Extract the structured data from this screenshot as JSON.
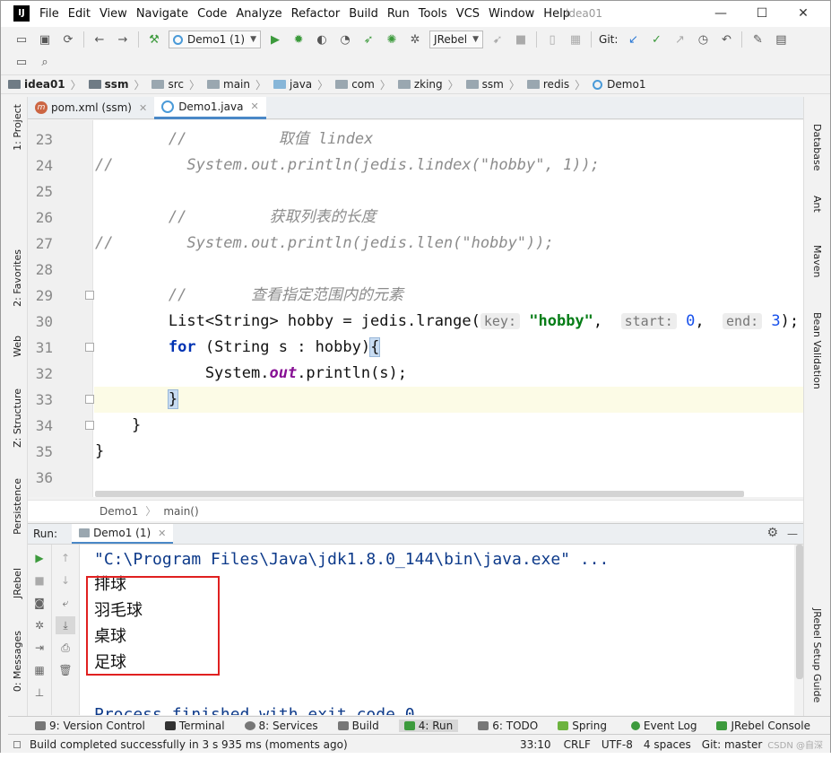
{
  "titlebar": {
    "title": "idea01",
    "menu": [
      "File",
      "Edit",
      "View",
      "Navigate",
      "Code",
      "Analyze",
      "Refactor",
      "Build",
      "Run",
      "Tools",
      "VCS",
      "Window",
      "Help"
    ],
    "minimize_label": "—",
    "maximize_label": "☐",
    "close_label": "✕"
  },
  "toolbar": {
    "run_config": "Demo1 (1)",
    "jrebel": "JRebel",
    "git_label": "Git:"
  },
  "breadcrumb": [
    "idea01",
    "ssm",
    "src",
    "main",
    "java",
    "com",
    "zking",
    "ssm",
    "redis",
    "Demo1"
  ],
  "tabs": [
    {
      "label": "pom.xml (ssm)"
    },
    {
      "label": "Demo1.java"
    }
  ],
  "left_tools": [
    "1: Project",
    "2: Favorites",
    "Web",
    "Z: Structure",
    "Persistence",
    "JRebel",
    "0: Messages"
  ],
  "right_tools": [
    "Database",
    "Ant",
    "Maven",
    "Bean Validation",
    "JRebel Setup Guide"
  ],
  "editor": {
    "lines": [
      {
        "n": "23",
        "parts": [
          [
            "        ",
            ""
          ],
          [
            "//          取值 lindex",
            "cm"
          ]
        ]
      },
      {
        "n": "24",
        "parts": [
          [
            "//        System.out.println(jedis.lindex(\"hobby\", 1));",
            "cm"
          ]
        ]
      },
      {
        "n": "25",
        "parts": [
          [
            "",
            ""
          ]
        ]
      },
      {
        "n": "26",
        "parts": [
          [
            "        ",
            ""
          ],
          [
            "//         获取列表的长度",
            "cm"
          ]
        ]
      },
      {
        "n": "27",
        "parts": [
          [
            "//        System.out.println(jedis.llen(\"hobby\"));",
            "cm"
          ]
        ]
      },
      {
        "n": "28",
        "parts": [
          [
            "",
            ""
          ]
        ]
      },
      {
        "n": "29",
        "parts": [
          [
            "        ",
            ""
          ],
          [
            "//       查看指定范围内的元素",
            "cm"
          ]
        ]
      },
      {
        "n": "30",
        "parts": [
          [
            "        List<String> hobby = jedis.lrange(",
            ""
          ],
          [
            "key:",
            "hint"
          ],
          [
            "\"hobby\"",
            "str"
          ],
          [
            ",  ",
            ""
          ],
          [
            "start:",
            "hint"
          ],
          [
            "0",
            "num"
          ],
          [
            ",  ",
            ""
          ],
          [
            "end:",
            "hint"
          ],
          [
            "3",
            "num"
          ],
          [
            ");",
            ""
          ]
        ]
      },
      {
        "n": "31",
        "parts": [
          [
            "        ",
            ""
          ],
          [
            "for",
            "kw"
          ],
          [
            " (String s : hobby)",
            ""
          ],
          [
            "{",
            "brace"
          ]
        ]
      },
      {
        "n": "32",
        "parts": [
          [
            "            System.",
            ""
          ],
          [
            "out",
            "fld"
          ],
          [
            ".println(s);",
            ""
          ]
        ]
      },
      {
        "n": "33",
        "parts": [
          [
            "        ",
            ""
          ],
          [
            "}",
            "brace"
          ]
        ]
      },
      {
        "n": "34",
        "parts": [
          [
            "    }",
            ""
          ]
        ]
      },
      {
        "n": "35",
        "parts": [
          [
            "}",
            ""
          ]
        ]
      },
      {
        "n": "36",
        "parts": [
          [
            "",
            ""
          ]
        ]
      }
    ],
    "breadcrumb": [
      "Demo1",
      "main()"
    ]
  },
  "run_panel": {
    "label": "Run:",
    "tab": "Demo1 (1)",
    "console_cmd": "\"C:\\Program Files\\Java\\jdk1.8.0_144\\bin\\java.exe\" ...",
    "output": [
      "排球",
      "羽毛球",
      "桌球",
      "足球"
    ],
    "finished": "Process finished with exit code 0"
  },
  "bottom_tabs": [
    "9: Version Control",
    "Terminal",
    "8: Services",
    "Build",
    "4: Run",
    "6: TODO",
    "Spring",
    "Event Log",
    "JRebel Console"
  ],
  "status": {
    "message": "Build completed successfully in 3 s 935 ms (moments ago)",
    "position": "33:10",
    "line_sep": "CRLF",
    "encoding": "UTF-8",
    "indent": "4 spaces",
    "git": "Git: master",
    "watermark": "CSDN @自深"
  }
}
